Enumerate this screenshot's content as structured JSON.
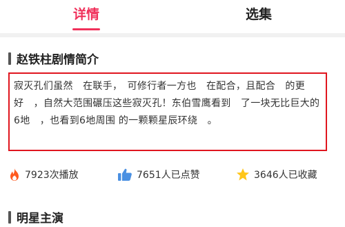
{
  "tabs": [
    {
      "label": "详情",
      "active": true
    },
    {
      "label": "选集",
      "active": false
    }
  ],
  "accent_color": "#f0305a",
  "synopsis": {
    "title": "赵铁柱剧情简介",
    "text": "寂灭孔们虽然　在联手，　可修行者一方也　在配合，且配合　的更　好　，自然大范围碾压这些寂灭孔！东伯雪鹰看到　了一块无比巨大的6地　，也看到6地周围 的一颗颗星辰环绕　。",
    "highlight_border_color": "#e0151e"
  },
  "stats": {
    "plays": {
      "icon": "fire-icon",
      "text": "7923次播放"
    },
    "likes": {
      "icon": "thumbs-up-icon",
      "text": "7651人已点赞"
    },
    "favorites": {
      "icon": "star-icon",
      "text": "3646人已收藏"
    }
  },
  "stars_section": {
    "title": "明星主演"
  }
}
